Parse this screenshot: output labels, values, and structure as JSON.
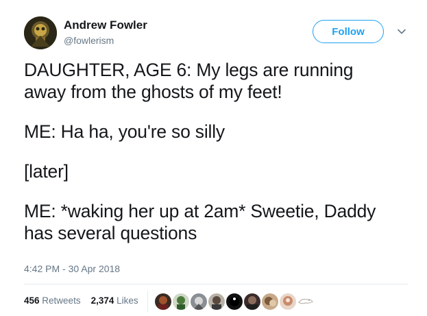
{
  "author": {
    "name": "Andrew Fowler",
    "handle": "@fowlerism"
  },
  "follow_label": "Follow",
  "tweet_lines": [
    "DAUGHTER, AGE 6: My legs are running",
    "away from the ghosts of my feet!",
    "ME: Ha ha, you're so silly",
    "[later]",
    "ME: *waking her up at 2am* Sweetie, Daddy",
    "has several questions"
  ],
  "timestamp": "4:42 PM - 30 Apr 2018",
  "stats": {
    "retweets_count": "456",
    "retweets_label": "Retweets",
    "likes_count": "2,374",
    "likes_label": "Likes"
  },
  "icons": {
    "more": "chevron-down-icon"
  },
  "colors": {
    "accent": "#1da1f2",
    "text": "#14171a",
    "muted": "#657786",
    "divider": "#e6ecf0"
  }
}
